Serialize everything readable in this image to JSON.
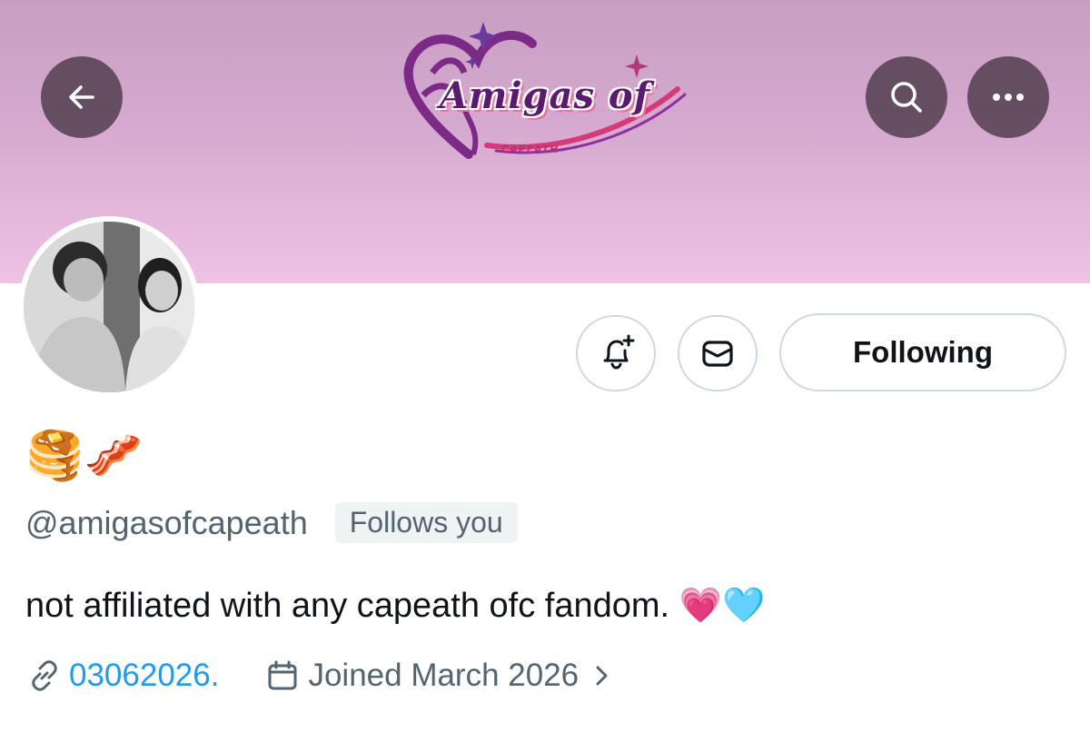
{
  "header": {
    "back_icon": "arrow-left-icon",
    "search_icon": "search-icon",
    "more_icon": "more-horizontal-icon",
    "banner_colors": [
      "#c79fc3",
      "#efc2e4"
    ],
    "logo": {
      "text": "Amigas of",
      "subtext": "CAPEATH"
    }
  },
  "actions": {
    "notify_icon": "bell-plus-icon",
    "message_icon": "envelope-icon",
    "follow_label": "Following"
  },
  "profile": {
    "display_name": "🥞🥓",
    "handle": "@amigasofcapeath",
    "follows_you": "Follows you",
    "bio": "not affiliated with any capeath ofc fandom. 💗🩵",
    "link_icon": "link-icon",
    "link": "03062026.",
    "calendar_icon": "calendar-icon",
    "joined": "Joined March 2026",
    "joined_chevron": "chevron-right-icon"
  },
  "colors": {
    "link": "#1d9bf0",
    "muted_text": "#536471",
    "border": "#cfd9de"
  }
}
